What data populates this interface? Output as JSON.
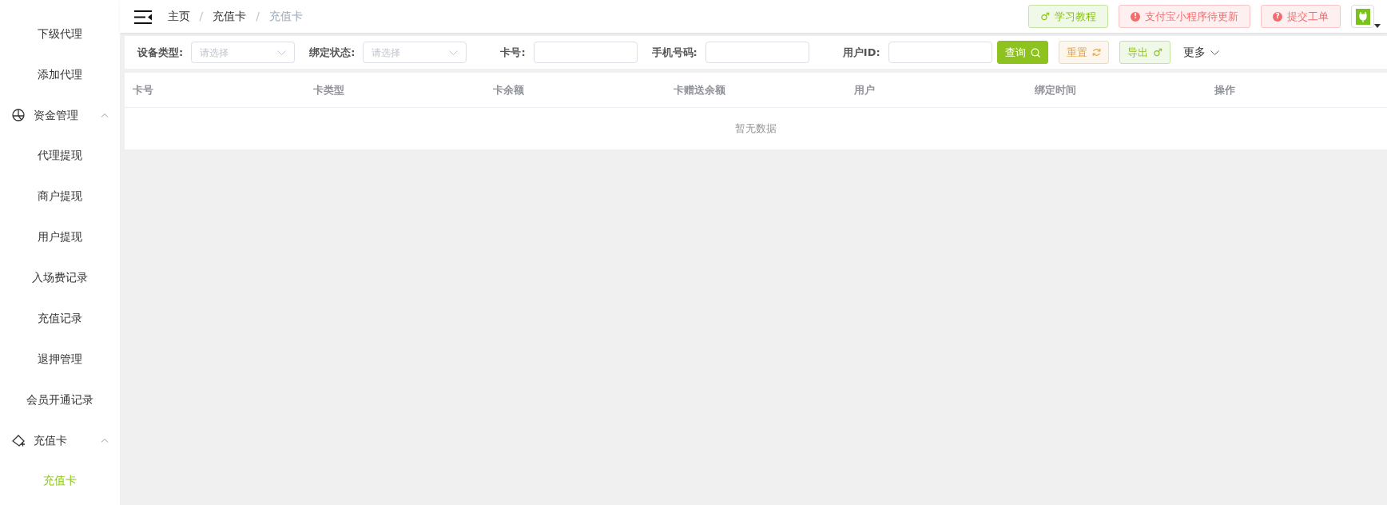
{
  "sidebar": {
    "items": [
      {
        "kind": "link",
        "label": "下级代理",
        "selected": false
      },
      {
        "kind": "link",
        "label": "添加代理",
        "selected": false
      },
      {
        "kind": "group",
        "label": "资金管理",
        "expanded": true,
        "children": [
          {
            "kind": "link",
            "label": "代理提现",
            "selected": false
          },
          {
            "kind": "link",
            "label": "商户提现",
            "selected": false
          },
          {
            "kind": "link",
            "label": "用户提现",
            "selected": false
          },
          {
            "kind": "link",
            "label": "入场费记录",
            "selected": false
          },
          {
            "kind": "link",
            "label": "充值记录",
            "selected": false
          },
          {
            "kind": "link",
            "label": "退押管理",
            "selected": false
          },
          {
            "kind": "link",
            "label": "会员开通记录",
            "selected": false
          }
        ]
      },
      {
        "kind": "group",
        "label": "充值卡",
        "expanded": true,
        "children": [
          {
            "kind": "link",
            "label": "充值卡",
            "selected": true
          }
        ]
      }
    ]
  },
  "breadcrumb": {
    "separator": "/",
    "items": [
      {
        "label": "主页",
        "current": false
      },
      {
        "label": "充值卡",
        "current": false
      },
      {
        "label": "充值卡",
        "current": true
      }
    ]
  },
  "header_buttons": [
    {
      "kind": "success",
      "icon": "♂",
      "label": "学习教程"
    },
    {
      "kind": "danger",
      "icon": "!",
      "label": "支付宝小程序待更新"
    },
    {
      "kind": "danger",
      "icon": "?",
      "label": "提交工单"
    }
  ],
  "filters": [
    {
      "kind": "select",
      "label": "设备类型:",
      "placeholder": "请选择"
    },
    {
      "kind": "select",
      "label": "绑定状态:",
      "placeholder": "请选择"
    },
    {
      "kind": "input",
      "label": "卡号:"
    },
    {
      "kind": "input",
      "label": "手机号码:"
    },
    {
      "kind": "input",
      "label": "用户ID:"
    }
  ],
  "filter_buttons": [
    {
      "kind": "primary",
      "label": "查询"
    },
    {
      "kind": "warning",
      "label": "重置"
    },
    {
      "kind": "success",
      "label": "导出",
      "icon": "♂"
    },
    {
      "kind": "more",
      "label": "更多"
    }
  ],
  "table": {
    "columns": [
      "卡号",
      "卡类型",
      "卡余额",
      "卡赠送余额",
      "用户",
      "绑定时间",
      "操作"
    ],
    "empty_text": "暂无数据"
  }
}
